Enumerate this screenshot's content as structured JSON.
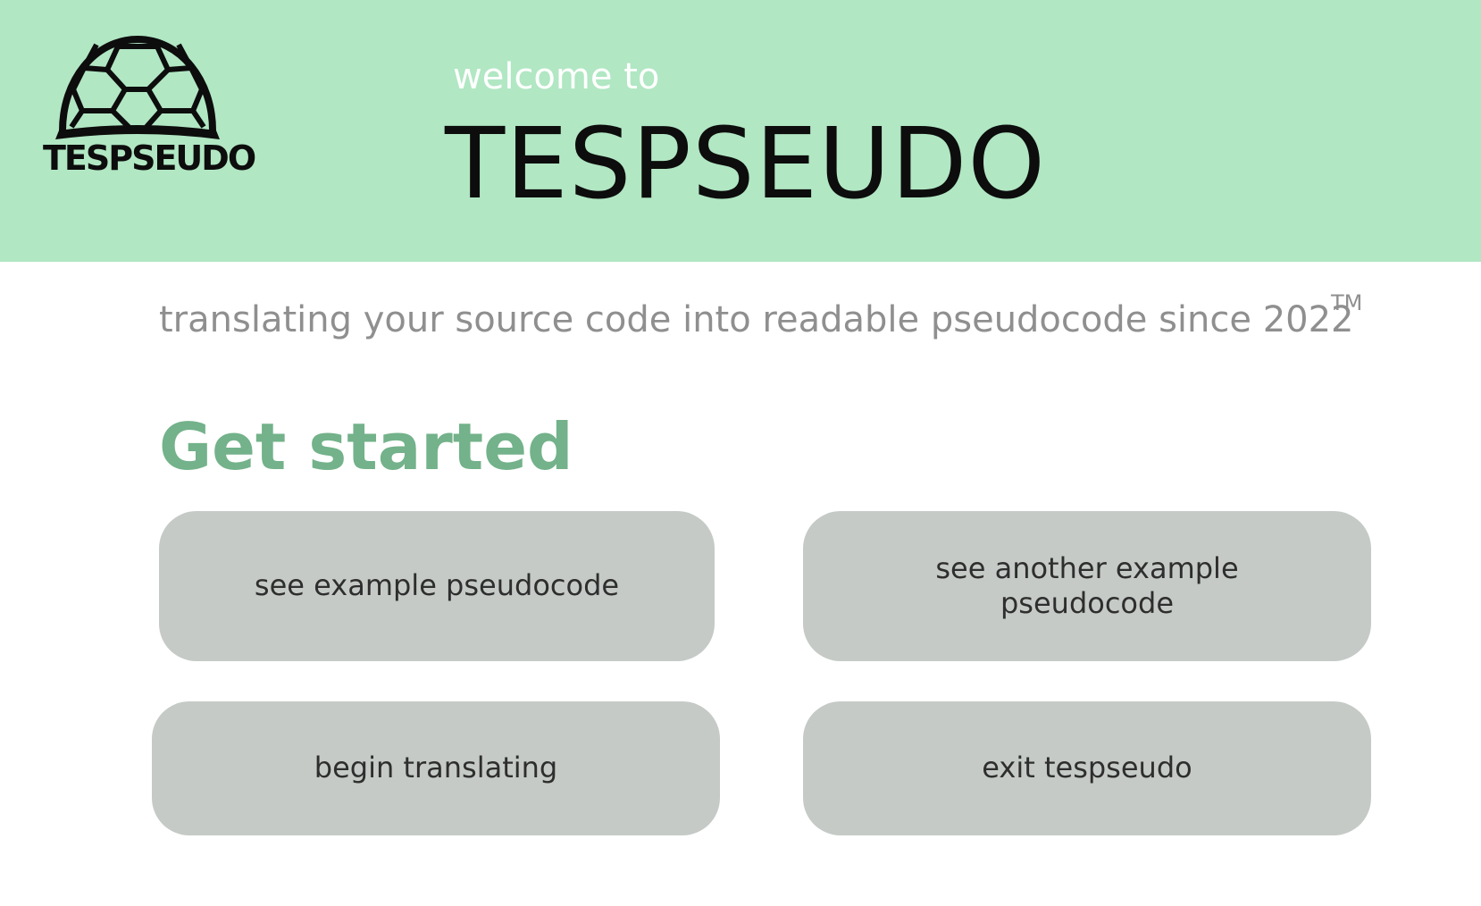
{
  "header": {
    "logo_text": "TESPSEUDO",
    "welcome": "welcome to",
    "title": "TESPSEUDO"
  },
  "tagline": {
    "text": "translating your source code into readable pseudocode since 2022",
    "trademark": "TM"
  },
  "main": {
    "heading": "Get started",
    "buttons": [
      {
        "label": "see example pseudocode"
      },
      {
        "label": "see another example pseudocode"
      },
      {
        "label": "begin translating"
      },
      {
        "label": "exit tespseudo"
      }
    ]
  },
  "colors": {
    "header_bg": "#b1e7c3",
    "heading": "#73b28a",
    "button_bg": "#c5cac6",
    "tagline": "#8f8f8f"
  },
  "icons": {
    "logo": "turtle-shell-icon"
  }
}
